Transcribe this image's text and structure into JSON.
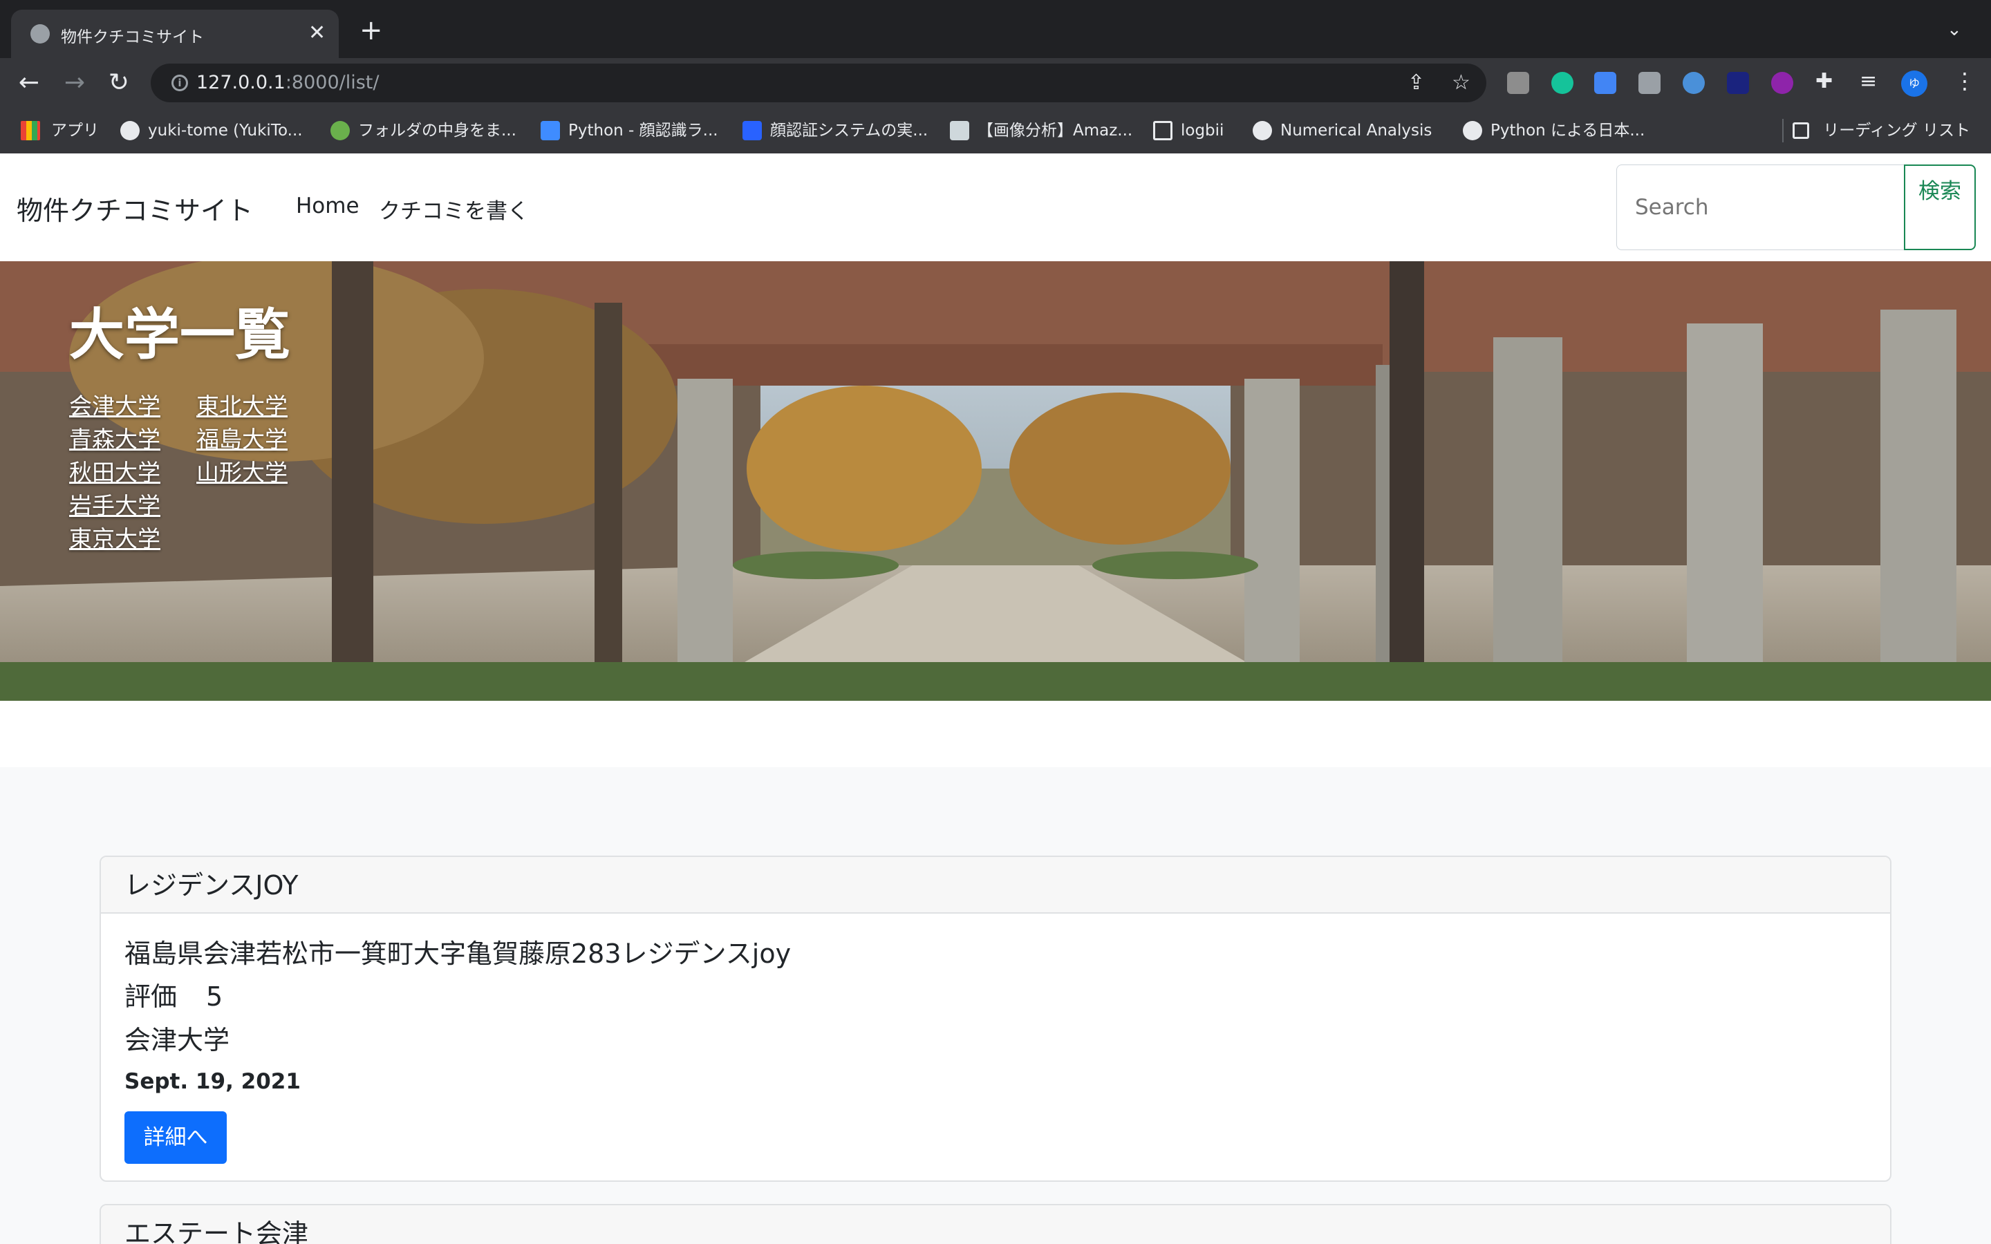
{
  "browser": {
    "tab_title": "物件クチコミサイト",
    "url_host": "127.0.0.1",
    "url_rest": ":8000/list/",
    "bookmarks": [
      {
        "label": "アプリ"
      },
      {
        "label": "yuki-tome (YukiTo..."
      },
      {
        "label": "フォルダの中身をま..."
      },
      {
        "label": "Python - 顔認識ラ..."
      },
      {
        "label": "顔認証システムの実..."
      },
      {
        "label": "【画像分析】Amaz..."
      },
      {
        "label": "logbii"
      },
      {
        "label": "Numerical Analysis"
      },
      {
        "label": "Python による日本..."
      }
    ],
    "reading_list": "リーディング リスト",
    "profile_initial": "ゆ"
  },
  "site": {
    "brand": "物件クチコミサイト",
    "nav": [
      "Home",
      "クチコミを書く"
    ],
    "search_placeholder": "Search",
    "search_button": "検索"
  },
  "hero": {
    "title": "大学一覧",
    "universities": [
      "会津大学",
      "青森大学",
      "秋田大学",
      "岩手大学",
      "東京大学",
      "東北大学",
      "福島大学",
      "山形大学"
    ]
  },
  "listings": [
    {
      "name": "レジデンスJOY",
      "address": "福島県会津若松市一箕町大字亀賀藤原283レジデンスjoy",
      "rating_label": "評価",
      "rating_value": "5",
      "university": "会津大学",
      "date": "Sept. 19, 2021",
      "button": "詳細へ"
    },
    {
      "name": "エステート会津"
    }
  ]
}
